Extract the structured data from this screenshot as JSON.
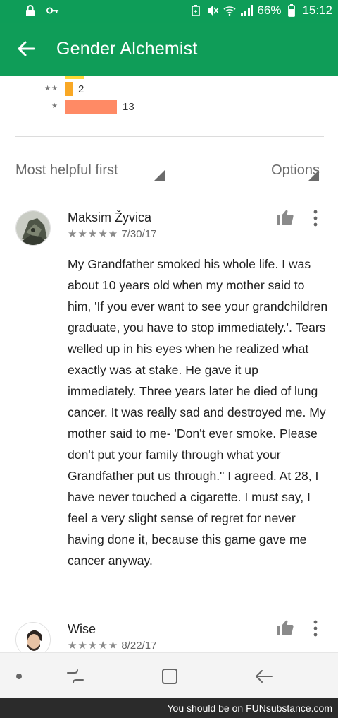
{
  "status_bar": {
    "battery": "66%",
    "time": "15:12",
    "icons": [
      "lock-icon",
      "key-icon",
      "battery-saver-icon",
      "mute-icon",
      "wifi-icon",
      "signal-icon",
      "battery-icon"
    ]
  },
  "app_bar": {
    "title": "Gender Alchemist",
    "back_icon": "arrow-back-icon"
  },
  "rating_histogram": [
    {
      "stars": "★★",
      "count": "2",
      "fraction": 0.08,
      "color": "#f9a825"
    },
    {
      "stars": "★",
      "count": "13",
      "fraction": 0.52,
      "color": "#ff8a65"
    }
  ],
  "sort_bar": {
    "sort_label": "Most helpful first",
    "options_label": "Options"
  },
  "reviews": [
    {
      "author": "Maksim Žyvica",
      "stars": "★★★★★",
      "date": "7/30/17",
      "text": "My Grandfather smoked his whole life. I was about 10 years old when my mother said to him, 'If you ever want to see your grandchildren graduate, you have to stop immediately.'. Tears welled up in his eyes when he realized what exactly was at stake. He gave it up immediately. Three years later he died of lung cancer. It was really sad and destroyed me. My mother said to me- 'Don't ever smoke. Please don't put your family through what your Grandfather put us through.\" I agreed. At 28, I have never touched a cigarette. I must say, I feel a very slight sense of regret for never having done it, because this game gave me cancer anyway."
    },
    {
      "author": "Wise",
      "stars": "★★★★★",
      "date": "8/22/17",
      "text": ""
    }
  ],
  "nav_bar": {
    "icons": [
      "dot-icon",
      "recents-icon",
      "home-icon",
      "back-icon"
    ]
  },
  "watermark": {
    "text": "You should be on FUNsubstance.com"
  },
  "colors": {
    "brand_green": "#0f9d58",
    "status_green": "#0e9d58"
  }
}
